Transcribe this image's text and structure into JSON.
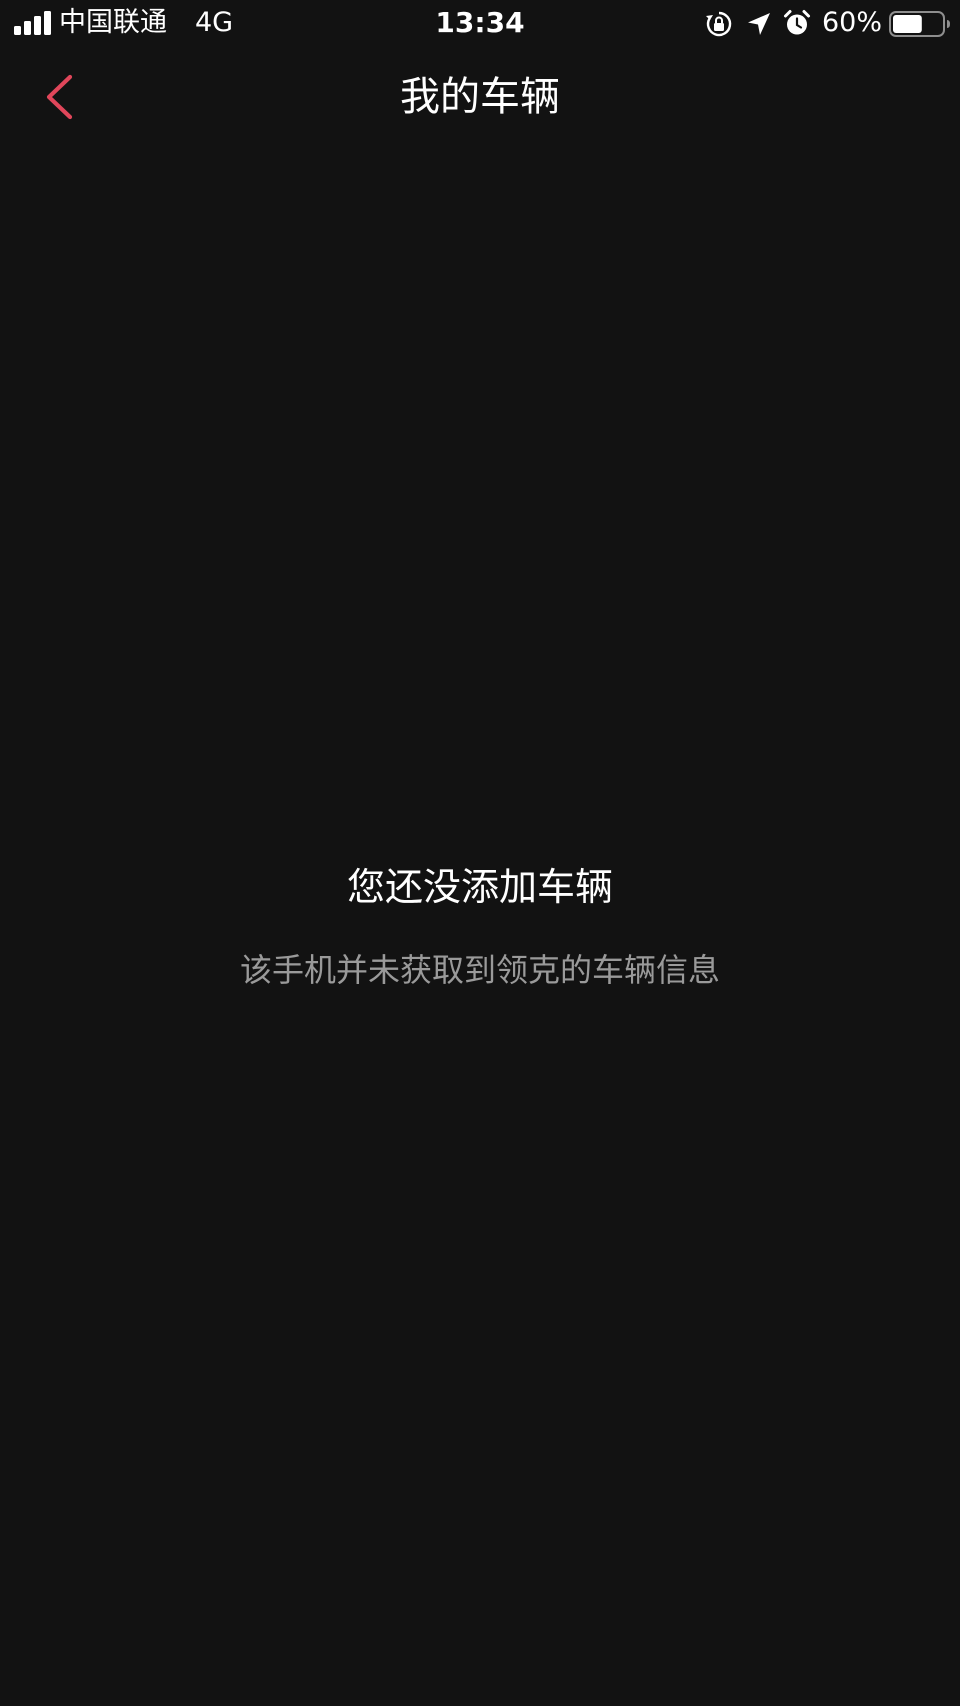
{
  "status_bar": {
    "carrier": "中国联通",
    "network": "4G",
    "time": "13:34",
    "battery_percent": "60%",
    "battery_level": 0.6,
    "icons": [
      "signal-icon",
      "rotation-lock-icon",
      "location-icon",
      "alarm-icon",
      "battery-icon"
    ]
  },
  "nav": {
    "title": "我的车辆",
    "back_icon": "chevron-left-icon"
  },
  "empty_state": {
    "title": "您还没添加车辆",
    "description": "该手机并未获取到领克的车辆信息"
  },
  "colors": {
    "background": "#121212",
    "accent": "#e0465a",
    "text_primary": "#ffffff",
    "text_secondary": "#9a9a9a"
  }
}
